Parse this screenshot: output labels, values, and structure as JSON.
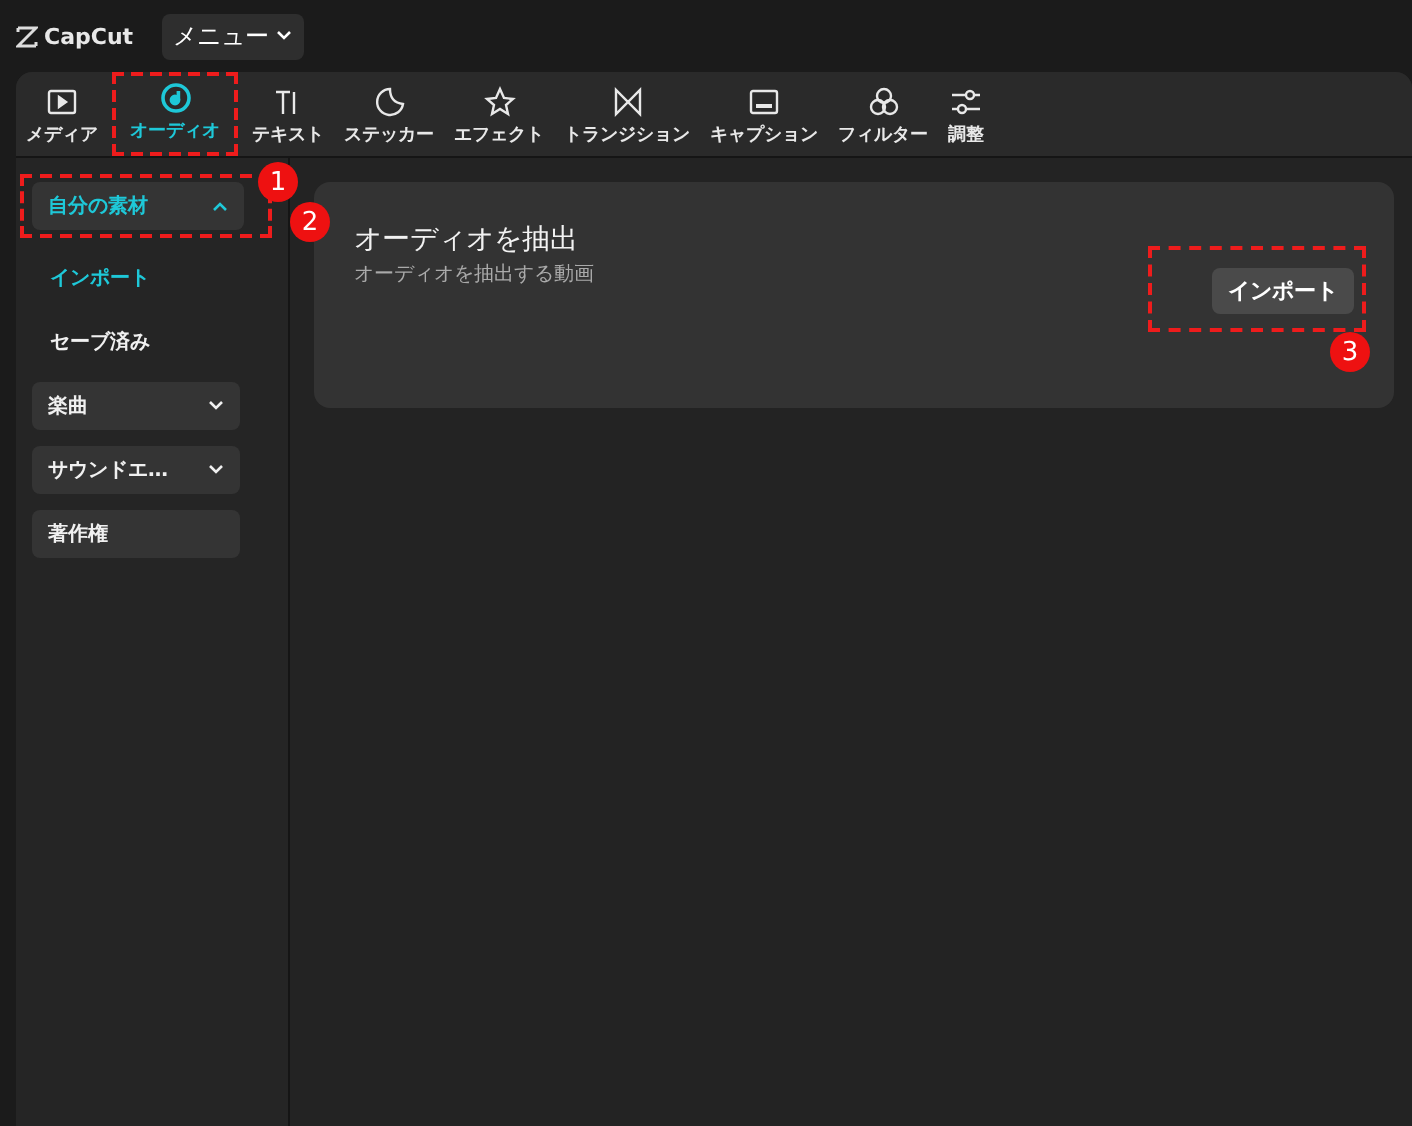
{
  "app": {
    "logo": "CapCut",
    "menu": "メニュー"
  },
  "tabs": [
    {
      "label": "メディア",
      "selected": false
    },
    {
      "label": "オーディオ",
      "selected": true,
      "callout": "1"
    },
    {
      "label": "テキスト",
      "selected": false
    },
    {
      "label": "ステッカー",
      "selected": false
    },
    {
      "label": "エフェクト",
      "selected": false
    },
    {
      "label": "トランジション",
      "selected": false
    },
    {
      "label": "キャプション",
      "selected": false
    },
    {
      "label": "フィルター",
      "selected": false
    },
    {
      "label": "調整",
      "selected": false
    }
  ],
  "sidebar": {
    "items": [
      {
        "kind": "group",
        "label": "自分の素材",
        "expanded": true,
        "selected": true,
        "callout": "2"
      },
      {
        "kind": "link",
        "label": "インポート",
        "selected": true
      },
      {
        "kind": "link",
        "label": "セーブ済み",
        "selected": false
      },
      {
        "kind": "group",
        "label": "楽曲",
        "expanded": false,
        "selected": false
      },
      {
        "kind": "group",
        "label": "サウンドエ…",
        "expanded": false,
        "selected": false
      },
      {
        "kind": "plain",
        "label": "著作権",
        "selected": false
      }
    ]
  },
  "card": {
    "title": "オーディオを抽出",
    "subtitle": "オーディオを抽出する動画",
    "button": "インポート",
    "callout": "3"
  }
}
